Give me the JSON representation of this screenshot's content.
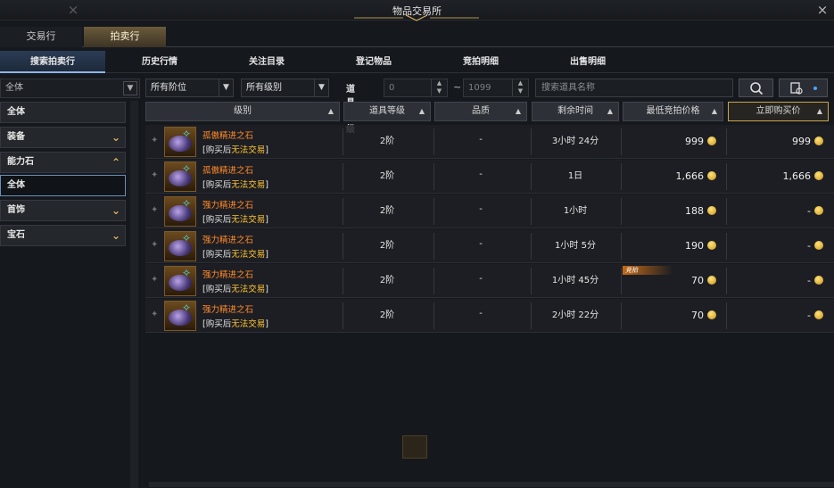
{
  "window": {
    "title": "物品交易所",
    "close_icon": "×"
  },
  "main_tabs": [
    {
      "label": "交易行"
    },
    {
      "label": "拍卖行"
    }
  ],
  "sub_tabs": [
    {
      "label": "搜索拍卖行"
    },
    {
      "label": "历史行情"
    },
    {
      "label": "关注目录"
    },
    {
      "label": "登记物品"
    },
    {
      "label": "竞拍明细"
    },
    {
      "label": "出售明细"
    }
  ],
  "sidebar": {
    "category_select": "全体",
    "items": [
      {
        "label": "全体"
      },
      {
        "label": "装备",
        "arrow": "⌄"
      },
      {
        "label": "能力石",
        "arrow": "⌃"
      },
      {
        "label": "全体"
      },
      {
        "label": "首饰",
        "arrow": "⌄"
      },
      {
        "label": "宝石",
        "arrow": "⌄"
      }
    ]
  },
  "filters": {
    "tier_select": "所有阶位",
    "grade_select": "所有级别",
    "item_level_label": "道具等级",
    "level_min": "0",
    "level_range_sep": "~",
    "level_max": "1099",
    "search_placeholder": "搜索道具名称"
  },
  "table": {
    "headers": [
      {
        "label": "级别"
      },
      {
        "label": "道具等级"
      },
      {
        "label": "品质"
      },
      {
        "label": "剩余时间"
      },
      {
        "label": "最低竞拍价格"
      },
      {
        "label": "立即购买价"
      }
    ],
    "sort_icon": "▲",
    "rows": [
      {
        "name": "孤傲精进之石",
        "note_prefix": "[购买后",
        "note_warn": "无法交易",
        "note_suffix": "]",
        "level": "2阶",
        "quality": "-",
        "time": "3小时 24分",
        "min_bid": "999",
        "buy_now": "999"
      },
      {
        "name": "孤傲精进之石",
        "note_prefix": "[购买后",
        "note_warn": "无法交易",
        "note_suffix": "]",
        "level": "2阶",
        "quality": "-",
        "time": "1日",
        "min_bid": "1,666",
        "buy_now": "1,666"
      },
      {
        "name": "强力精进之石",
        "note_prefix": "[购买后",
        "note_warn": "无法交易",
        "note_suffix": "]",
        "level": "2阶",
        "quality": "-",
        "time": "1小时",
        "min_bid": "188",
        "buy_now": "-"
      },
      {
        "name": "强力精进之石",
        "note_prefix": "[购买后",
        "note_warn": "无法交易",
        "note_suffix": "]",
        "level": "2阶",
        "quality": "-",
        "time": "1小时 5分",
        "min_bid": "190",
        "buy_now": "-"
      },
      {
        "name": "强力精进之石",
        "note_prefix": "[购买后",
        "note_warn": "无法交易",
        "note_suffix": "]",
        "level": "2阶",
        "quality": "-",
        "time": "1小时 45分",
        "min_bid": "70",
        "buy_now": "-",
        "badge": "竞拍"
      },
      {
        "name": "强力精进之石",
        "note_prefix": "[购买后",
        "note_warn": "无法交易",
        "note_suffix": "]",
        "level": "2阶",
        "quality": "-",
        "time": "2小时 22分",
        "min_bid": "70",
        "buy_now": "-"
      }
    ]
  }
}
